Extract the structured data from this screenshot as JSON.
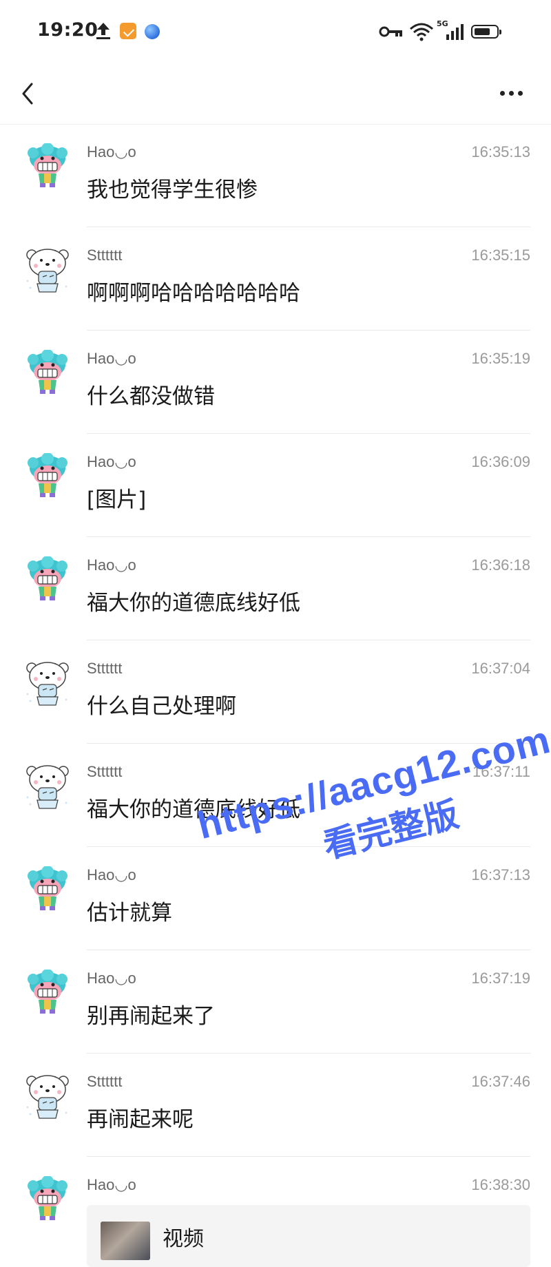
{
  "status_bar": {
    "time": "19:20",
    "network": "5G",
    "icons": [
      "upload-arrow-icon",
      "app-badge-icon",
      "browser-icon",
      "vpn-key-icon",
      "wifi-icon",
      "signal-icon",
      "battery-icon"
    ]
  },
  "nav": {
    "back_icon": "chevron-left-icon",
    "more_icon": "more-dots-icon"
  },
  "messages": [
    {
      "sender": "Hao◡o",
      "time": "16:35:13",
      "text": "我也觉得学生很惨",
      "avatar": "blue-monster"
    },
    {
      "sender": "Stttttt",
      "time": "16:35:15",
      "text": "啊啊啊哈哈哈哈哈哈哈",
      "avatar": "white-bear"
    },
    {
      "sender": "Hao◡o",
      "time": "16:35:19",
      "text": "什么都没做错",
      "avatar": "blue-monster"
    },
    {
      "sender": "Hao◡o",
      "time": "16:36:09",
      "text": "[图片]",
      "avatar": "blue-monster"
    },
    {
      "sender": "Hao◡o",
      "time": "16:36:18",
      "text": "福大你的道德底线好低",
      "avatar": "blue-monster"
    },
    {
      "sender": "Stttttt",
      "time": "16:37:04",
      "text": "什么自己处理啊",
      "avatar": "white-bear"
    },
    {
      "sender": "Stttttt",
      "time": "16:37:11",
      "text": "福大你的道德底线好低",
      "avatar": "white-bear"
    },
    {
      "sender": "Hao◡o",
      "time": "16:37:13",
      "text": "估计就算",
      "avatar": "blue-monster"
    },
    {
      "sender": "Hao◡o",
      "time": "16:37:19",
      "text": "别再闹起来了",
      "avatar": "blue-monster"
    },
    {
      "sender": "Stttttt",
      "time": "16:37:46",
      "text": "再闹起来呢",
      "avatar": "white-bear"
    },
    {
      "sender": "Hao◡o",
      "time": "16:38:30",
      "video_label": "视频",
      "avatar": "blue-monster"
    }
  ],
  "watermark": {
    "url": "https://aacg12.com",
    "subtitle": "看完整版"
  },
  "colors": {
    "watermark": "#4a6cf4",
    "time_text": "#9a9a9a",
    "name_text": "#666666",
    "separator": "#e9e9e9"
  }
}
